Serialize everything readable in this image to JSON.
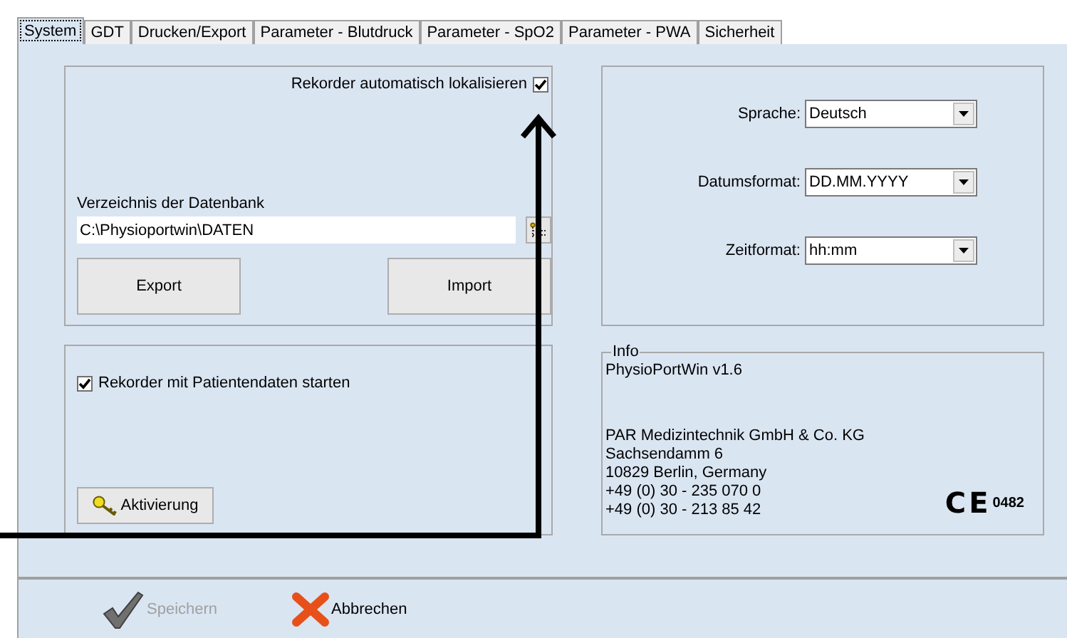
{
  "tabs": [
    {
      "label": "System",
      "selected": true
    },
    {
      "label": "GDT",
      "selected": false
    },
    {
      "label": "Drucken/Export",
      "selected": false
    },
    {
      "label": "Parameter - Blutdruck",
      "selected": false
    },
    {
      "label": "Parameter - SpO2",
      "selected": false
    },
    {
      "label": "Parameter - PWA",
      "selected": false
    },
    {
      "label": "Sicherheit",
      "selected": false
    }
  ],
  "database_panel": {
    "auto_locate": {
      "label": "Rekorder automatisch lokalisieren",
      "checked": true
    },
    "directory_label": "Verzeichnis der Datenbank",
    "directory_value": "C:\\Physioportwin\\DATEN",
    "buttons": [
      "Export",
      "Import"
    ]
  },
  "format_panel": {
    "fields": [
      {
        "label": "Sprache:",
        "value": "Deutsch"
      },
      {
        "label": "Datumsformat:",
        "value": "DD.MM.YYYY"
      },
      {
        "label": "Zeitformat:",
        "value": "hh:mm"
      }
    ]
  },
  "start_panel": {
    "start_with_patient": {
      "label": "Rekorder mit Patientendaten starten",
      "checked": true
    },
    "activation_button": "Aktivierung"
  },
  "info": {
    "title": "Info",
    "version": "PhysioPortWin v1.6",
    "address_lines": [
      "PAR Medizintechnik GmbH & Co. KG",
      "Sachsendamm 6",
      "10829 Berlin, Germany",
      "+49 (0) 30 - 235 070 0",
      "+49 (0) 30 - 213 85 42"
    ],
    "ce_mark": "CE",
    "ce_number": "0482"
  },
  "footer": [
    {
      "label": "Speichern",
      "kind": "save",
      "disabled": true
    },
    {
      "label": "Abbrechen",
      "kind": "cancel",
      "disabled": false
    }
  ]
}
